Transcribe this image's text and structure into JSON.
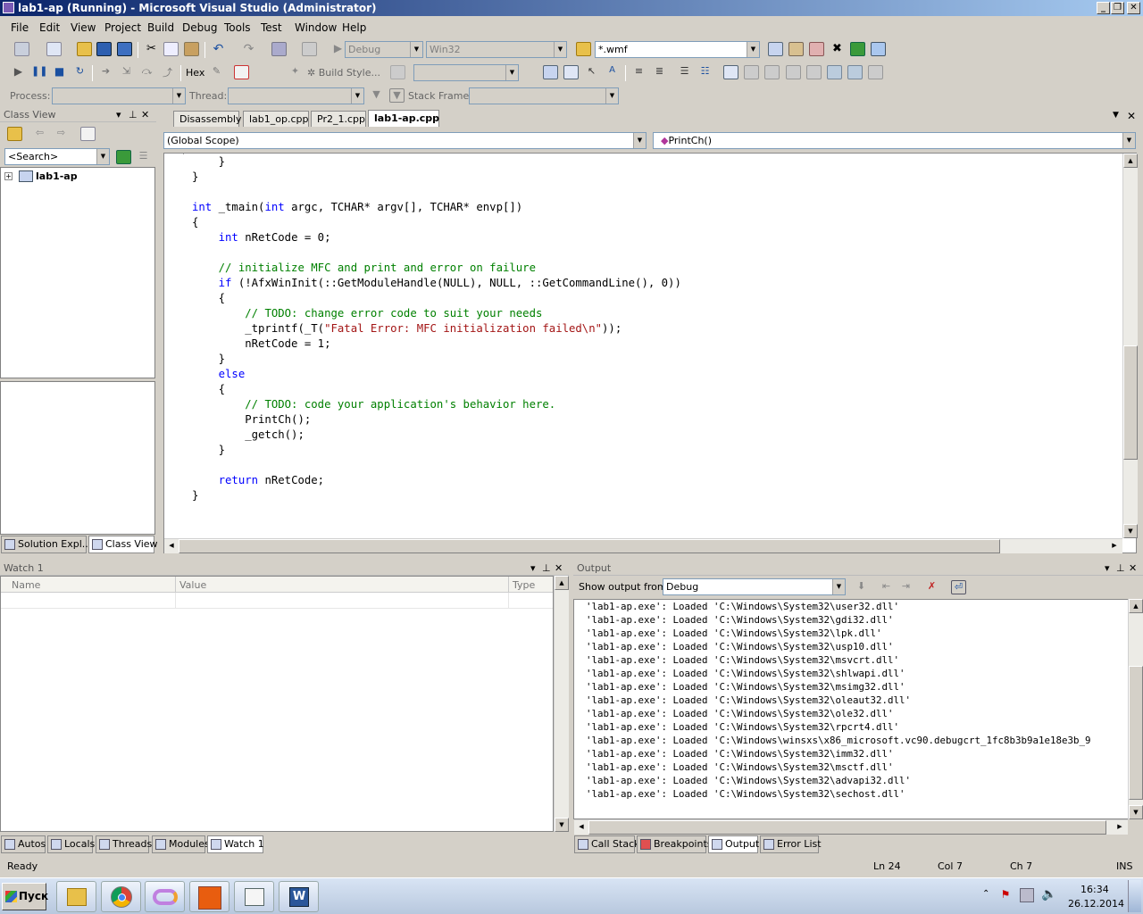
{
  "window": {
    "title": "lab1-ap (Running) - Microsoft Visual Studio (Administrator)",
    "min": "_",
    "max": "❐",
    "close": "✕"
  },
  "menus": [
    "File",
    "Edit",
    "View",
    "Project",
    "Build",
    "Debug",
    "Tools",
    "Test",
    "Window",
    "Help"
  ],
  "toolbar1": {
    "config": "Debug",
    "platform": "Win32",
    "find": "*.wmf"
  },
  "toolbar2": {
    "hex": "Hex",
    "build_style": "Build Style..."
  },
  "toolbar3": {
    "process_label": "Process:",
    "thread_label": "Thread:",
    "stack_label": "Stack Frame:"
  },
  "class_view": {
    "title": "Class View",
    "search_placeholder": "<Search>",
    "tree_root": "lab1-ap",
    "pin": "⊥",
    "close": "✕",
    "menu": "▾"
  },
  "left_tabs": [
    "Solution Expl...",
    "Class View"
  ],
  "editor": {
    "tabs": [
      "Disassembly",
      "lab1_op.cpp",
      "Pr2_1.cpp",
      "lab1-ap.cpp"
    ],
    "scope": "(Global Scope)",
    "member": "PrintCh()",
    "lines": [
      [
        [
          "",
          "    }"
        ]
      ],
      [
        [
          "",
          "}"
        ]
      ],
      [
        [
          "",
          ""
        ]
      ],
      [
        [
          "kw",
          "int"
        ],
        [
          "",
          " _tmain("
        ],
        [
          "kw",
          "int"
        ],
        [
          "",
          " argc, TCHAR* argv[], TCHAR* envp[])"
        ]
      ],
      [
        [
          "",
          "{"
        ]
      ],
      [
        [
          "",
          "    "
        ],
        [
          "kw",
          "int"
        ],
        [
          "",
          " nRetCode = 0;"
        ]
      ],
      [
        [
          "",
          ""
        ]
      ],
      [
        [
          "",
          "    "
        ],
        [
          "cm",
          "// initialize MFC and print and error on failure"
        ]
      ],
      [
        [
          "",
          "    "
        ],
        [
          "kw",
          "if"
        ],
        [
          "",
          " (!AfxWinInit(::GetModuleHandle(NULL), NULL, ::GetCommandLine(), 0))"
        ]
      ],
      [
        [
          "",
          "    {"
        ]
      ],
      [
        [
          "",
          "        "
        ],
        [
          "cm",
          "// TODO: change error code to suit your needs"
        ]
      ],
      [
        [
          "",
          "        _tprintf(_T("
        ],
        [
          "st",
          "\"Fatal Error: MFC initialization failed\\n\""
        ],
        [
          "",
          "));"
        ]
      ],
      [
        [
          "",
          "        nRetCode = 1;"
        ]
      ],
      [
        [
          "",
          "    }"
        ]
      ],
      [
        [
          "",
          "    "
        ],
        [
          "kw",
          "else"
        ]
      ],
      [
        [
          "",
          "    {"
        ]
      ],
      [
        [
          "",
          "        "
        ],
        [
          "cm",
          "// TODO: code your application's behavior here."
        ]
      ],
      [
        [
          "",
          "        PrintCh();"
        ]
      ],
      [
        [
          "",
          "        _getch();"
        ]
      ],
      [
        [
          "",
          "    }"
        ]
      ],
      [
        [
          "",
          ""
        ]
      ],
      [
        [
          "",
          "    "
        ],
        [
          "kw",
          "return"
        ],
        [
          "",
          " nRetCode;"
        ]
      ],
      [
        [
          "",
          "}"
        ]
      ]
    ]
  },
  "watch": {
    "title": "Watch 1",
    "columns": [
      "Name",
      "Value",
      "Type"
    ]
  },
  "output": {
    "title": "Output",
    "show_from_label": "Show output from:",
    "source": "Debug",
    "lines": [
      "'lab1-ap.exe': Loaded 'C:\\Windows\\System32\\user32.dll'",
      "'lab1-ap.exe': Loaded 'C:\\Windows\\System32\\gdi32.dll'",
      "'lab1-ap.exe': Loaded 'C:\\Windows\\System32\\lpk.dll'",
      "'lab1-ap.exe': Loaded 'C:\\Windows\\System32\\usp10.dll'",
      "'lab1-ap.exe': Loaded 'C:\\Windows\\System32\\msvcrt.dll'",
      "'lab1-ap.exe': Loaded 'C:\\Windows\\System32\\shlwapi.dll'",
      "'lab1-ap.exe': Loaded 'C:\\Windows\\System32\\msimg32.dll'",
      "'lab1-ap.exe': Loaded 'C:\\Windows\\System32\\oleaut32.dll'",
      "'lab1-ap.exe': Loaded 'C:\\Windows\\System32\\ole32.dll'",
      "'lab1-ap.exe': Loaded 'C:\\Windows\\System32\\rpcrt4.dll'",
      "'lab1-ap.exe': Loaded 'C:\\Windows\\winsxs\\x86_microsoft.vc90.debugcrt_1fc8b3b9a1e18e3b_9",
      "'lab1-ap.exe': Loaded 'C:\\Windows\\System32\\imm32.dll'",
      "'lab1-ap.exe': Loaded 'C:\\Windows\\System32\\msctf.dll'",
      "'lab1-ap.exe': Loaded 'C:\\Windows\\System32\\advapi32.dll'",
      "'lab1-ap.exe': Loaded 'C:\\Windows\\System32\\sechost.dll'"
    ]
  },
  "bottom_left_tabs": [
    "Autos",
    "Locals",
    "Threads",
    "Modules",
    "Watch 1"
  ],
  "bottom_right_tabs": [
    "Call Stack",
    "Breakpoints",
    "Output",
    "Error List"
  ],
  "status": {
    "ready": "Ready",
    "ln": "Ln 24",
    "col": "Col 7",
    "ch": "Ch 7",
    "mode": "INS"
  },
  "taskbar": {
    "start": "Пуск",
    "time": "16:34",
    "date": "26.12.2014"
  }
}
